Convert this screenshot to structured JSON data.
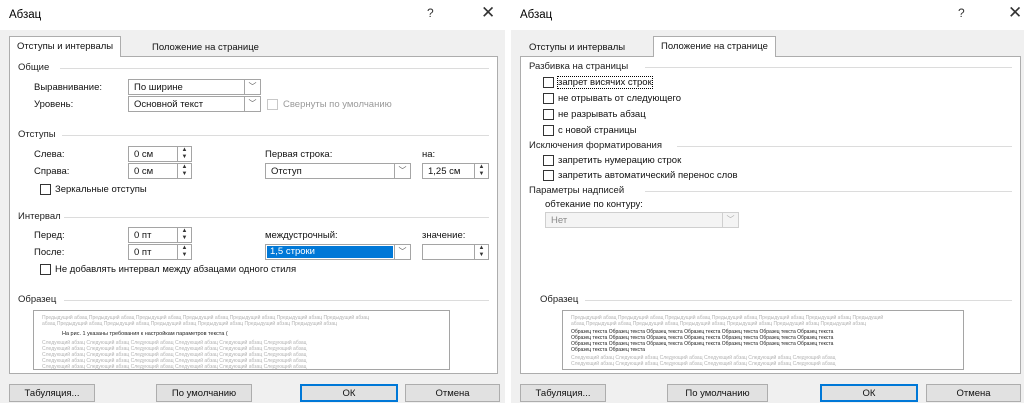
{
  "left": {
    "title": "Абзац",
    "help": "?",
    "close": "✕",
    "tabs": [
      "Отступы и интервалы",
      "Положение на странице"
    ],
    "general": {
      "group": "Общие",
      "align_label": "Выравнивание:",
      "align_value": "По ширине",
      "level_label": "Уровень:",
      "level_value": "Основной текст",
      "collapsed_label": "Свернуты по умолчанию"
    },
    "indents": {
      "group": "Отступы",
      "left_label": "Слева:",
      "left_value": "0 см",
      "right_label": "Справа:",
      "right_value": "0 см",
      "first_line_label": "Первая строка:",
      "first_line_value": "Отступ",
      "by_label": "на:",
      "by_value": "1,25 см",
      "mirror_label": "Зеркальные отступы"
    },
    "spacing": {
      "group": "Интервал",
      "before_label": "Перед:",
      "before_value": "0 пт",
      "after_label": "После:",
      "after_value": "0 пт",
      "line_label": "междустрочный:",
      "line_value": "1,5 строки",
      "value_label": "значение:",
      "value_value": "",
      "no_space_label": "Не добавлять интервал между абзацами одного стиля"
    },
    "sample": {
      "group": "Образец",
      "prev1": "Предыдущий абзац Предыдущий абзац Предыдущий абзац Предыдущий абзац Предыдущий абзац Предыдущий абзац Предыдущий абзац",
      "prev2": "абзац Предыдущий абзац Предыдущий абзац Предыдущий абзац Предыдущий абзац Предыдущий абзац Предыдущий абзац",
      "current": "На рис. 1 указаны требования к настройкам параметров текста (",
      "next1": "Следующий абзац Следующий абзац Следующий абзац Следующий абзац Следующий абзац Следующий абзац",
      "next2": "Следующий абзац Следующий абзац Следующий абзац Следующий абзац Следующий абзац Следующий абзац",
      "next3": "Следующий абзац Следующий абзац Следующий абзац Следующий абзац Следующий абзац Следующий абзац",
      "next4": "Следующий абзац Следующий абзац Следующий абзац Следующий абзац Следующий абзац Следующий абзац",
      "next5": "Следующий абзац Следующий абзац Следующий абзац Следующий абзац Следующий абзац Следующий абзац"
    },
    "buttons": {
      "tabs": "Табуляция...",
      "default": "По умолчанию",
      "ok": "ОК",
      "cancel": "Отмена"
    }
  },
  "right": {
    "title": "Абзац",
    "help": "?",
    "close": "✕",
    "tabs": [
      "Отступы и интервалы",
      "Положение на странице"
    ],
    "pagination": {
      "group": "Разбивка на страницы",
      "widow": "запрет висячих строк",
      "keep_next": "не отрывать от следующего",
      "keep_lines": "не разрывать абзац",
      "page_break": "с новой страницы"
    },
    "exceptions": {
      "group": "Исключения форматирования",
      "suppress_numbers": "запретить нумерацию строк",
      "no_hyphen": "запретить автоматический перенос слов"
    },
    "textbox": {
      "group": "Параметры надписей",
      "wrap_label": "обтекание по контуру:",
      "wrap_value": "Нет"
    },
    "sample": {
      "group": "Образец",
      "prev1": "Предыдущий абзац Предыдущий абзац Предыдущий абзац Предыдущий абзац Предыдущий абзац Предыдущий абзац Предыдущий",
      "prev2": "абзац Предыдущий абзац Предыдущий абзац Предыдущий абзац Предыдущий абзац Предыдущий абзац Предыдущий абзац",
      "s1": "Образец текста Образец текста Образец текста Образец текста Образец текста Образец текста Образец текста",
      "s2": "Образец текста Образец текста Образец текста Образец текста Образец текста Образец текста Образец текста",
      "s3": "Образец текста Образец текста Образец текста Образец текста Образец текста Образец текста Образец текста",
      "s4": "Образец текста Образец текста",
      "next1": "Следующий абзац Следующий абзац Следующий абзац Следующий абзац Следующий абзац Следующий абзац",
      "next2": "Следующий абзац Следующий абзац Следующий абзац Следующий абзац Следующий абзац Следующий абзац"
    },
    "buttons": {
      "tabs": "Табуляция...",
      "default": "По умолчанию",
      "ok": "ОК",
      "cancel": "Отмена"
    }
  }
}
